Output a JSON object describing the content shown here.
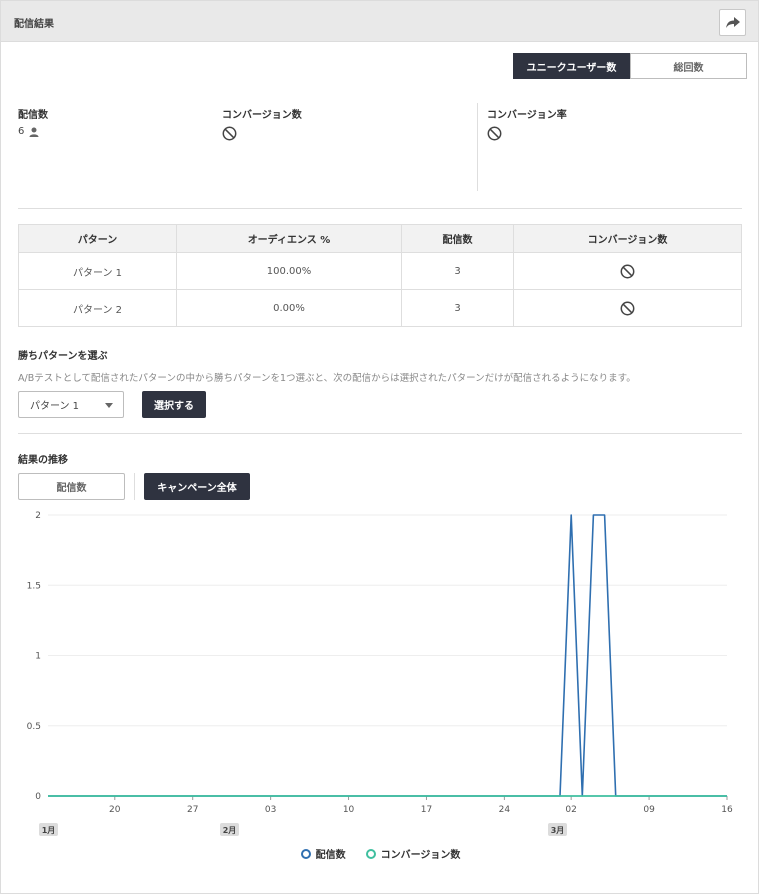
{
  "header": {
    "title": "配信結果"
  },
  "user_toggle": {
    "unique_label": "ユニークユーザー数",
    "total_label": "総回数"
  },
  "stats": {
    "deliveries_label": "配信数",
    "deliveries_value": "6",
    "conversions_label": "コンバージョン数",
    "conversion_rate_label": "コンバージョン率"
  },
  "pattern_table": {
    "headers": [
      "パターン",
      "オーディエンス %",
      "配信数",
      "コンバージョン数"
    ],
    "rows": [
      {
        "pattern": "パターン 1",
        "audience": "100.00%",
        "deliveries": "3"
      },
      {
        "pattern": "パターン 2",
        "audience": "0.00%",
        "deliveries": "3"
      }
    ]
  },
  "winner": {
    "title": "勝ちパターンを選ぶ",
    "description": "A/Bテストとして配信されたパターンの中から勝ちパターンを1つ選ぶと、次の配信からは選択されたパターンだけが配信されるようになります。",
    "selected_pattern": "パターン 1",
    "select_button": "選択する"
  },
  "trend": {
    "title": "結果の推移",
    "metric_tab": "配信数",
    "scope_tab": "キャンペーン全体"
  },
  "colors": {
    "deliveries": "#2f6fb0",
    "conversions": "#3fbf9f",
    "dark": "#2f3340"
  },
  "chart_data": {
    "type": "line",
    "ylim": [
      0,
      2
    ],
    "y_ticks": [
      "0",
      "0.5",
      "1",
      "1.5",
      "2"
    ],
    "x_ticks": [
      "20",
      "27",
      "03",
      "10",
      "17",
      "24",
      "02",
      "09",
      "16"
    ],
    "month_labels": [
      "1月",
      "2月",
      "3月"
    ],
    "x_start": "2022-01-14",
    "x_end": "2022-03-16",
    "series": [
      {
        "name": "配信数",
        "points": [
          [
            "2022-01-14",
            0
          ],
          [
            "2022-03-01",
            0
          ],
          [
            "2022-03-02",
            2
          ],
          [
            "2022-03-03",
            0
          ],
          [
            "2022-03-04",
            2
          ],
          [
            "2022-03-05",
            2
          ],
          [
            "2022-03-06",
            0
          ],
          [
            "2022-03-16",
            0
          ]
        ]
      },
      {
        "name": "コンバージョン数",
        "points": [
          [
            "2022-01-14",
            0
          ],
          [
            "2022-03-16",
            0
          ]
        ]
      }
    ]
  }
}
